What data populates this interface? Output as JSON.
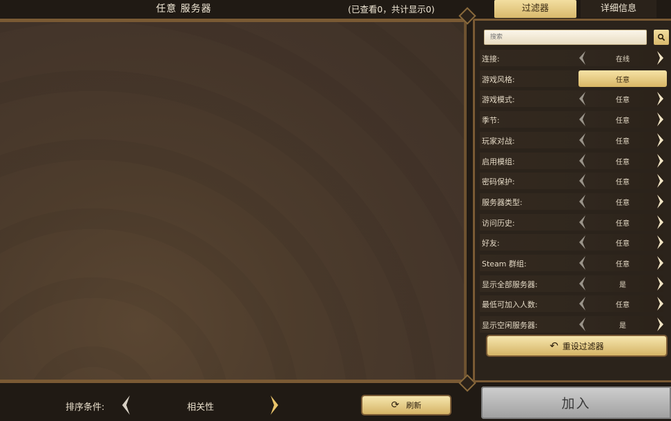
{
  "header": {
    "title": "任意 服务器",
    "count_text": "(已查看0，共计显示0)"
  },
  "tabs": {
    "filters": "过滤器",
    "details": "详细信息"
  },
  "search": {
    "placeholder": "搜索",
    "button_icon": "search-icon"
  },
  "filters": [
    {
      "label": "连接:",
      "value": "在线"
    },
    {
      "label": "游戏风格:",
      "value": "任意"
    },
    {
      "label": "游戏模式:",
      "value": "任意"
    },
    {
      "label": "季节:",
      "value": "任意"
    },
    {
      "label": "玩家对战:",
      "value": "任意"
    },
    {
      "label": "启用模组:",
      "value": "任意"
    },
    {
      "label": "密码保护:",
      "value": "任意"
    },
    {
      "label": "服务器类型:",
      "value": "任意"
    },
    {
      "label": "访问历史:",
      "value": "任意"
    },
    {
      "label": "好友:",
      "value": "任意"
    },
    {
      "label": "Steam 群组:",
      "value": "任意"
    },
    {
      "label": "显示全部服务器:",
      "value": "是"
    },
    {
      "label": "最低可加入人数:",
      "value": "任意"
    },
    {
      "label": "显示空闲服务器:",
      "value": "是"
    }
  ],
  "reset_button": {
    "label": "重设过滤器",
    "icon": "undo-icon"
  },
  "sort": {
    "label": "排序条件:",
    "value": "相关性"
  },
  "refresh_button": {
    "label": "刷新",
    "icon": "refresh-icon"
  },
  "join_button": {
    "label": "加入"
  },
  "colors": {
    "gold_button": "#e8cd86",
    "panel_border": "#7a5a34",
    "background": "#201a14"
  }
}
